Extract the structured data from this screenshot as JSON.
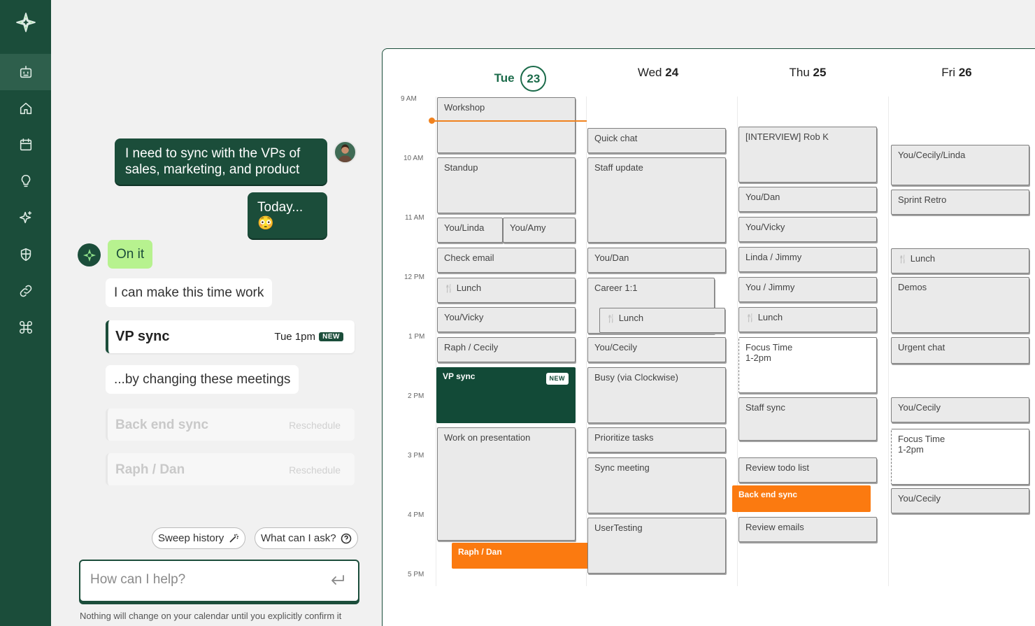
{
  "sidebar": {
    "items": [
      {
        "name": "logo-icon",
        "icon": "sparkle-logo"
      },
      {
        "name": "assistant-icon",
        "icon": "robot",
        "active": true
      },
      {
        "name": "home-icon",
        "icon": "home"
      },
      {
        "name": "calendar-icon",
        "icon": "calendar"
      },
      {
        "name": "ideas-icon",
        "icon": "lightbulb"
      },
      {
        "name": "ai-sparkle-icon",
        "icon": "sparkles"
      },
      {
        "name": "shield-icon",
        "icon": "shield"
      },
      {
        "name": "link-icon",
        "icon": "link"
      },
      {
        "name": "integrations-icon",
        "icon": "command"
      }
    ]
  },
  "chat": {
    "user_message_1": "I need to sync with the VPs of sales, marketing, and product",
    "user_message_2": "Today...",
    "user_message_2_emoji": "😳",
    "ai_reply_1": "On it",
    "ai_reply_2": "I can make this time work",
    "proposed_event": {
      "title": "VP sync",
      "time": "Tue 1pm",
      "badge": "NEW"
    },
    "ai_reply_3": "...by changing these meetings",
    "changes": [
      {
        "title": "Back end sync",
        "action": "Reschedule"
      },
      {
        "title": "Raph / Dan",
        "action": "Reschedule"
      }
    ],
    "suggestions": [
      "Sweep history",
      "What can I ask?"
    ],
    "input_placeholder": "How can I help?",
    "disclaimer": "Nothing will change on your calendar until you explicitly confirm it"
  },
  "calendar": {
    "days": [
      {
        "dow": "Tue",
        "date": "23",
        "today": true
      },
      {
        "dow": "Wed",
        "date": "24"
      },
      {
        "dow": "Thu",
        "date": "25"
      },
      {
        "dow": "Fri",
        "date": "26"
      }
    ],
    "hours": [
      "9 AM",
      "10 AM",
      "11 AM",
      "12 PM",
      "1 PM",
      "2 PM",
      "3 PM",
      "4 PM",
      "5 PM"
    ],
    "events": {
      "tue": [
        "Workshop",
        "Standup",
        "You/Linda",
        "You/Amy",
        "Check email",
        "Lunch",
        "You/Vicky",
        "Raph / Cecily",
        "VP sync",
        "Work on presentation",
        "Raph / Dan"
      ],
      "wed": [
        "Quick chat",
        "Staff update",
        "You/Dan",
        "Career 1:1",
        "Lunch",
        "You/Cecily",
        "Busy (via Clockwise)",
        "Prioritize tasks",
        "Sync meeting",
        "UserTesting"
      ],
      "thu": [
        "[INTERVIEW] Rob K",
        "You/Dan",
        "You/Vicky",
        "Linda / Jimmy",
        "You / Jimmy",
        "Lunch",
        "Focus Time",
        "1-2pm",
        "Staff sync",
        "Review todo list",
        "Back end sync",
        "Review emails"
      ],
      "fri": [
        "You/Cecily/Linda",
        "Sprint Retro",
        "Lunch",
        "Demos",
        "Urgent chat",
        "You/Cecily",
        "Focus Time",
        "1-2pm",
        "You/Cecily"
      ]
    },
    "new_badge": "NEW"
  },
  "colors": {
    "brand_dark": "#1b4d3a",
    "accent_green": "#b7f28f",
    "orange": "#fb7a10",
    "now_line": "#f0821e"
  }
}
